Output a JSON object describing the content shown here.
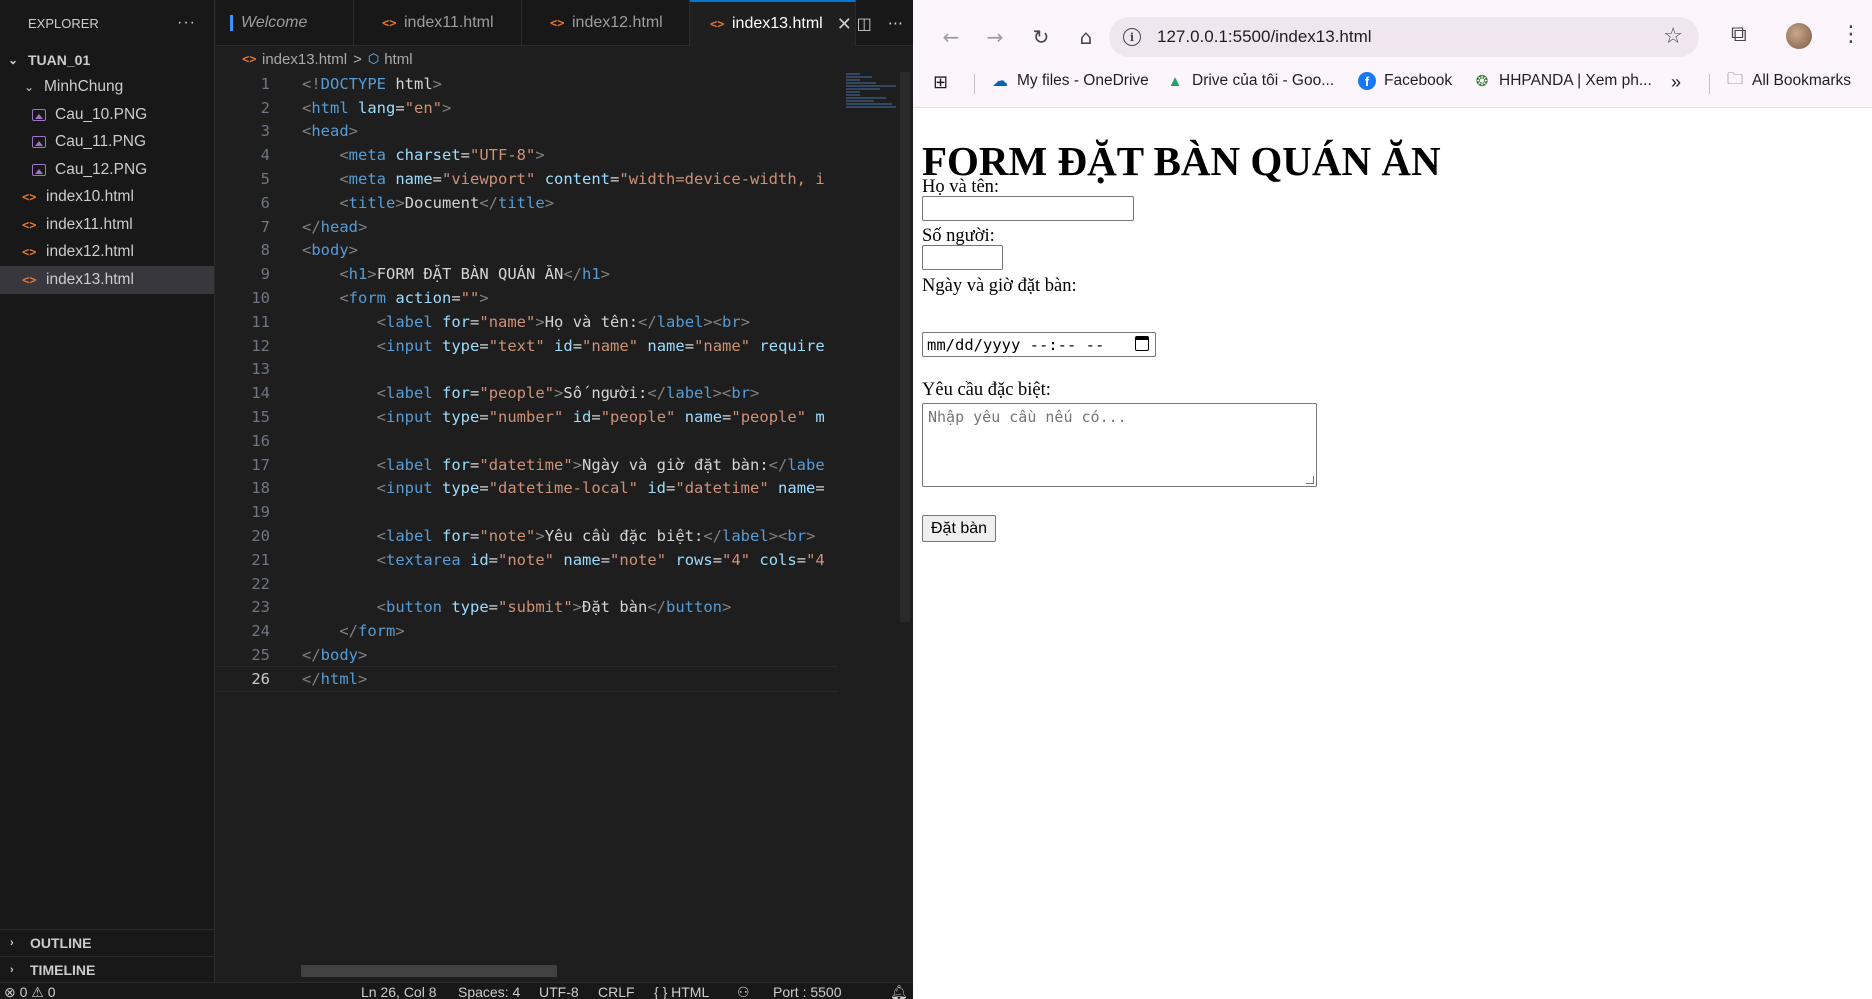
{
  "explorer": {
    "title": "EXPLORER",
    "more": "···",
    "root": "TUAN_01",
    "folder": "MinhChung",
    "images": [
      "Cau_10.PNG",
      "Cau_11.PNG",
      "Cau_12.PNG"
    ],
    "files": [
      "index10.html",
      "index11.html",
      "index12.html",
      "index13.html"
    ],
    "outline": "OUTLINE",
    "timeline": "TIMELINE"
  },
  "tabs": [
    "Welcome",
    "index11.html",
    "index12.html",
    "index13.html"
  ],
  "tab_icon": "<>",
  "breadcrumb": {
    "file": "index13.html",
    "sep": ">",
    "node": "html"
  },
  "code_lines": [
    [
      [
        "brk",
        "<!"
      ],
      [
        "tag",
        "DOCTYPE"
      ],
      [
        "txt",
        " html"
      ],
      [
        "brk",
        ">"
      ]
    ],
    [
      [
        "brk",
        "<"
      ],
      [
        "tag",
        "html"
      ],
      [
        "txt",
        " "
      ],
      [
        "attr",
        "lang"
      ],
      [
        "txt",
        "="
      ],
      [
        "str",
        "\"en\""
      ],
      [
        "brk",
        ">"
      ]
    ],
    [
      [
        "brk",
        "<"
      ],
      [
        "tag",
        "head"
      ],
      [
        "brk",
        ">"
      ]
    ],
    [
      [
        "txt",
        "    "
      ],
      [
        "brk",
        "<"
      ],
      [
        "tag",
        "meta"
      ],
      [
        "txt",
        " "
      ],
      [
        "attr",
        "charset"
      ],
      [
        "txt",
        "="
      ],
      [
        "str",
        "\"UTF-8\""
      ],
      [
        "brk",
        ">"
      ]
    ],
    [
      [
        "txt",
        "    "
      ],
      [
        "brk",
        "<"
      ],
      [
        "tag",
        "meta"
      ],
      [
        "txt",
        " "
      ],
      [
        "attr",
        "name"
      ],
      [
        "txt",
        "="
      ],
      [
        "str",
        "\"viewport\""
      ],
      [
        "txt",
        " "
      ],
      [
        "attr",
        "content"
      ],
      [
        "txt",
        "="
      ],
      [
        "str",
        "\"width=device-width, i"
      ]
    ],
    [
      [
        "txt",
        "    "
      ],
      [
        "brk",
        "<"
      ],
      [
        "tag",
        "title"
      ],
      [
        "brk",
        ">"
      ],
      [
        "txt",
        "Document"
      ],
      [
        "brk",
        "</"
      ],
      [
        "tag",
        "title"
      ],
      [
        "brk",
        ">"
      ]
    ],
    [
      [
        "brk",
        "</"
      ],
      [
        "tag",
        "head"
      ],
      [
        "brk",
        ">"
      ]
    ],
    [
      [
        "brk",
        "<"
      ],
      [
        "tag",
        "body"
      ],
      [
        "brk",
        ">"
      ]
    ],
    [
      [
        "txt",
        "    "
      ],
      [
        "brk",
        "<"
      ],
      [
        "tag",
        "h1"
      ],
      [
        "brk",
        ">"
      ],
      [
        "txt",
        "FORM ĐẶT BÀN QUÁN ĂN"
      ],
      [
        "brk",
        "</"
      ],
      [
        "tag",
        "h1"
      ],
      [
        "brk",
        ">"
      ]
    ],
    [
      [
        "txt",
        "    "
      ],
      [
        "brk",
        "<"
      ],
      [
        "tag",
        "form"
      ],
      [
        "txt",
        " "
      ],
      [
        "attr",
        "action"
      ],
      [
        "txt",
        "="
      ],
      [
        "str",
        "\"\""
      ],
      [
        "brk",
        ">"
      ]
    ],
    [
      [
        "txt",
        "        "
      ],
      [
        "brk",
        "<"
      ],
      [
        "tag",
        "label"
      ],
      [
        "txt",
        " "
      ],
      [
        "attr",
        "for"
      ],
      [
        "txt",
        "="
      ],
      [
        "str",
        "\"name\""
      ],
      [
        "brk",
        ">"
      ],
      [
        "txt",
        "Họ và tên:"
      ],
      [
        "brk",
        "</"
      ],
      [
        "tag",
        "label"
      ],
      [
        "brk",
        "><"
      ],
      [
        "tag",
        "br"
      ],
      [
        "brk",
        ">"
      ]
    ],
    [
      [
        "txt",
        "        "
      ],
      [
        "brk",
        "<"
      ],
      [
        "tag",
        "input"
      ],
      [
        "txt",
        " "
      ],
      [
        "attr",
        "type"
      ],
      [
        "txt",
        "="
      ],
      [
        "str",
        "\"text\""
      ],
      [
        "txt",
        " "
      ],
      [
        "attr",
        "id"
      ],
      [
        "txt",
        "="
      ],
      [
        "str",
        "\"name\""
      ],
      [
        "txt",
        " "
      ],
      [
        "attr",
        "name"
      ],
      [
        "txt",
        "="
      ],
      [
        "str",
        "\"name\""
      ],
      [
        "txt",
        " "
      ],
      [
        "attr",
        "require"
      ]
    ],
    [],
    [
      [
        "txt",
        "        "
      ],
      [
        "brk",
        "<"
      ],
      [
        "tag",
        "label"
      ],
      [
        "txt",
        " "
      ],
      [
        "attr",
        "for"
      ],
      [
        "txt",
        "="
      ],
      [
        "str",
        "\"people\""
      ],
      [
        "brk",
        ">"
      ],
      [
        "txt",
        "Số người:"
      ],
      [
        "brk",
        "</"
      ],
      [
        "tag",
        "label"
      ],
      [
        "brk",
        "><"
      ],
      [
        "tag",
        "br"
      ],
      [
        "brk",
        ">"
      ]
    ],
    [
      [
        "txt",
        "        "
      ],
      [
        "brk",
        "<"
      ],
      [
        "tag",
        "input"
      ],
      [
        "txt",
        " "
      ],
      [
        "attr",
        "type"
      ],
      [
        "txt",
        "="
      ],
      [
        "str",
        "\"number\""
      ],
      [
        "txt",
        " "
      ],
      [
        "attr",
        "id"
      ],
      [
        "txt",
        "="
      ],
      [
        "str",
        "\"people\""
      ],
      [
        "txt",
        " "
      ],
      [
        "attr",
        "name"
      ],
      [
        "txt",
        "="
      ],
      [
        "str",
        "\"people\""
      ],
      [
        "txt",
        " "
      ],
      [
        "attr",
        "m"
      ]
    ],
    [],
    [
      [
        "txt",
        "        "
      ],
      [
        "brk",
        "<"
      ],
      [
        "tag",
        "label"
      ],
      [
        "txt",
        " "
      ],
      [
        "attr",
        "for"
      ],
      [
        "txt",
        "="
      ],
      [
        "str",
        "\"datetime\""
      ],
      [
        "brk",
        ">"
      ],
      [
        "txt",
        "Ngày và giờ đặt bàn:"
      ],
      [
        "brk",
        "</"
      ],
      [
        "tag",
        "labe"
      ]
    ],
    [
      [
        "txt",
        "        "
      ],
      [
        "brk",
        "<"
      ],
      [
        "tag",
        "input"
      ],
      [
        "txt",
        " "
      ],
      [
        "attr",
        "type"
      ],
      [
        "txt",
        "="
      ],
      [
        "str",
        "\"datetime-local\""
      ],
      [
        "txt",
        " "
      ],
      [
        "attr",
        "id"
      ],
      [
        "txt",
        "="
      ],
      [
        "str",
        "\"datetime\""
      ],
      [
        "txt",
        " "
      ],
      [
        "attr",
        "name"
      ],
      [
        "txt",
        "="
      ]
    ],
    [],
    [
      [
        "txt",
        "        "
      ],
      [
        "brk",
        "<"
      ],
      [
        "tag",
        "label"
      ],
      [
        "txt",
        " "
      ],
      [
        "attr",
        "for"
      ],
      [
        "txt",
        "="
      ],
      [
        "str",
        "\"note\""
      ],
      [
        "brk",
        ">"
      ],
      [
        "txt",
        "Yêu cầu đặc biệt:"
      ],
      [
        "brk",
        "</"
      ],
      [
        "tag",
        "label"
      ],
      [
        "brk",
        "><"
      ],
      [
        "tag",
        "br"
      ],
      [
        "brk",
        ">"
      ]
    ],
    [
      [
        "txt",
        "        "
      ],
      [
        "brk",
        "<"
      ],
      [
        "tag",
        "textarea"
      ],
      [
        "txt",
        " "
      ],
      [
        "attr",
        "id"
      ],
      [
        "txt",
        "="
      ],
      [
        "str",
        "\"note\""
      ],
      [
        "txt",
        " "
      ],
      [
        "attr",
        "name"
      ],
      [
        "txt",
        "="
      ],
      [
        "str",
        "\"note\""
      ],
      [
        "txt",
        " "
      ],
      [
        "attr",
        "rows"
      ],
      [
        "txt",
        "="
      ],
      [
        "str",
        "\"4\""
      ],
      [
        "txt",
        " "
      ],
      [
        "attr",
        "cols"
      ],
      [
        "txt",
        "="
      ],
      [
        "str",
        "\"4"
      ]
    ],
    [],
    [
      [
        "txt",
        "        "
      ],
      [
        "brk",
        "<"
      ],
      [
        "tag",
        "button"
      ],
      [
        "txt",
        " "
      ],
      [
        "attr",
        "type"
      ],
      [
        "txt",
        "="
      ],
      [
        "str",
        "\"submit\""
      ],
      [
        "brk",
        ">"
      ],
      [
        "txt",
        "Đặt bàn"
      ],
      [
        "brk",
        "</"
      ],
      [
        "tag",
        "button"
      ],
      [
        "brk",
        ">"
      ]
    ],
    [
      [
        "txt",
        "    "
      ],
      [
        "brk",
        "</"
      ],
      [
        "tag",
        "form"
      ],
      [
        "brk",
        ">"
      ]
    ],
    [
      [
        "brk",
        "</"
      ],
      [
        "tag",
        "body"
      ],
      [
        "brk",
        ">"
      ]
    ],
    [
      [
        "brk",
        "</"
      ],
      [
        "tag",
        "html"
      ],
      [
        "brk",
        ">"
      ]
    ]
  ],
  "current_line": 26,
  "statusbar": {
    "problems": "⊗ 0 ⚠ 0",
    "position": "Ln 26, Col 8",
    "spaces": "Spaces: 4",
    "encoding": "UTF-8",
    "eol": "CRLF",
    "language": "{ } HTML",
    "port": "Port : 5500"
  },
  "browser": {
    "url": "127.0.0.1:5500/index13.html",
    "bookmarks": [
      "My files - OneDrive",
      "Drive của tôi - Goo...",
      "Facebook",
      "HHPANDA | Xem ph..."
    ],
    "all_bookmarks": "All Bookmarks",
    "more_bookmarks": "»"
  },
  "page": {
    "heading": "FORM ĐẶT BÀN QUÁN ĂN",
    "name_label": "Họ và tên:",
    "people_label": "Số người:",
    "datetime_label": "Ngày và giờ đặt bàn:",
    "datetime_placeholder": "mm/dd/yyyy --:-- --",
    "note_label": "Yêu cầu đặc biệt:",
    "note_placeholder": "Nhập yêu cầu nếu có...",
    "submit_label": "Đặt bàn"
  },
  "colors": {
    "vscode_bg": "#1e1e1e",
    "accent": "#0078d4",
    "html_icon": "#e37933",
    "browser_chrome": "#fcf5fb"
  }
}
